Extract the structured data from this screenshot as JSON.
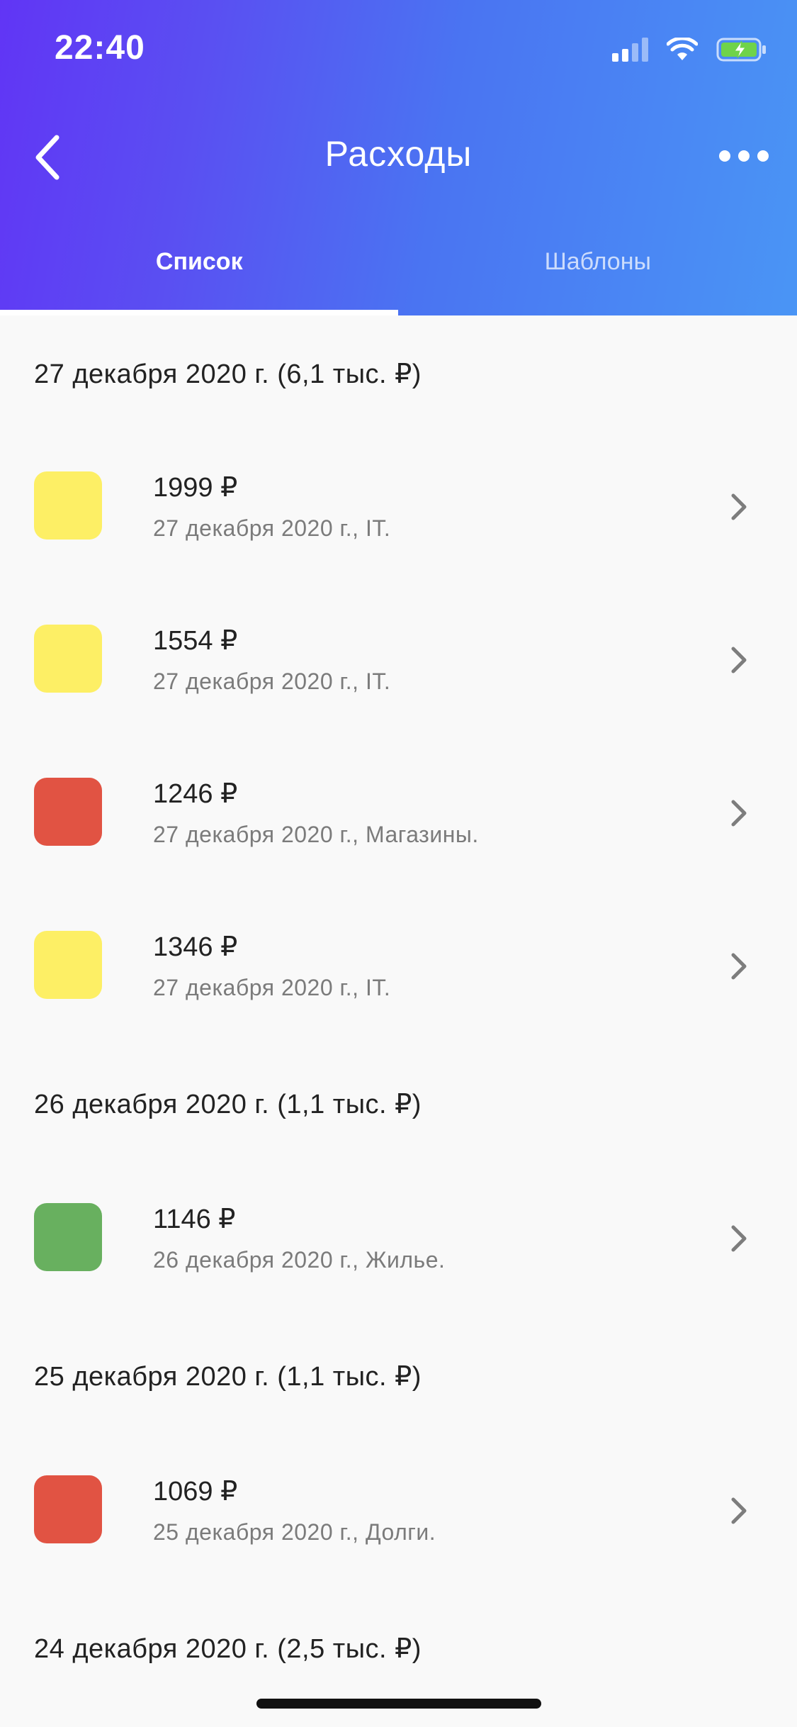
{
  "status_bar": {
    "time": "22:40",
    "icons": [
      "cellular-signal-icon",
      "wifi-icon",
      "battery-charging-icon"
    ],
    "battery_color": "#6fd34a"
  },
  "nav": {
    "back_icon": "chevron-left-icon",
    "title": "Расходы",
    "more_icon": "more-horizontal-icon"
  },
  "tabs": [
    {
      "label": "Список",
      "active": true
    },
    {
      "label": "Шаблоны",
      "active": false
    }
  ],
  "colors": {
    "header_gradient_start": "#6135f5",
    "header_gradient_end": "#4a95f5",
    "yellow": "#fdef65",
    "red": "#e15343",
    "green": "#68b05f"
  },
  "groups": [
    {
      "header": "27 декабря 2020 г. (6,1 тыс. ₽)",
      "items": [
        {
          "amount": "1999 ₽",
          "subtitle": "27 декабря 2020 г., IT.",
          "color": "#fdef65"
        },
        {
          "amount": "1554 ₽",
          "subtitle": "27 декабря 2020 г., IT.",
          "color": "#fdef65"
        },
        {
          "amount": "1246 ₽",
          "subtitle": "27 декабря 2020 г., Магазины.",
          "color": "#e15343"
        },
        {
          "amount": "1346 ₽",
          "subtitle": "27 декабря 2020 г., IT.",
          "color": "#fdef65"
        }
      ]
    },
    {
      "header": "26 декабря 2020 г. (1,1 тыс. ₽)",
      "items": [
        {
          "amount": "1146 ₽",
          "subtitle": "26 декабря 2020 г., Жилье.",
          "color": "#68b05f"
        }
      ]
    },
    {
      "header": "25 декабря 2020 г. (1,1 тыс. ₽)",
      "items": [
        {
          "amount": "1069 ₽",
          "subtitle": "25 декабря 2020 г., Долги.",
          "color": "#e15343"
        }
      ]
    },
    {
      "header": "24 декабря 2020 г. (2,5 тыс. ₽)",
      "items": []
    }
  ]
}
